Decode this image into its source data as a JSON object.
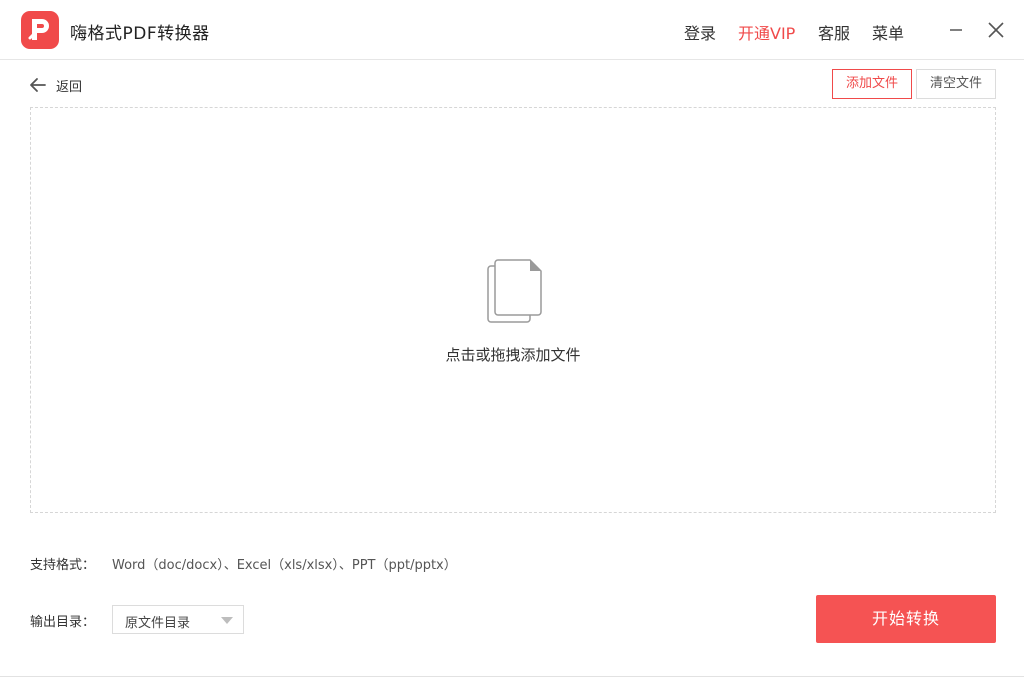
{
  "app": {
    "title": "嗨格式PDF转换器",
    "logo_icon": "pdf-converter-logo",
    "brand_color": "#f04a4a"
  },
  "header": {
    "menu": [
      {
        "label": "登录"
      },
      {
        "label": "开通VIP",
        "color": "#f04a4a"
      },
      {
        "label": "客服"
      },
      {
        "label": "菜单"
      }
    ],
    "window_controls": [
      "minimize-icon",
      "close-icon"
    ]
  },
  "toolbar": {
    "back_label": "返回",
    "add_file_label": "添加文件",
    "clear_files_label": "清空文件"
  },
  "dropzone": {
    "icon": "document-stack-icon",
    "hint": "点击或拖拽添加文件"
  },
  "formats": {
    "label": "支持格式：",
    "value": "Word（doc/docx）、Excel（xls/xlsx）、PPT（ppt/pptx）"
  },
  "output": {
    "label": "输出目录：",
    "selected": "原文件目录"
  },
  "actions": {
    "start_label": "开始转换",
    "start_color": "#f55353"
  }
}
